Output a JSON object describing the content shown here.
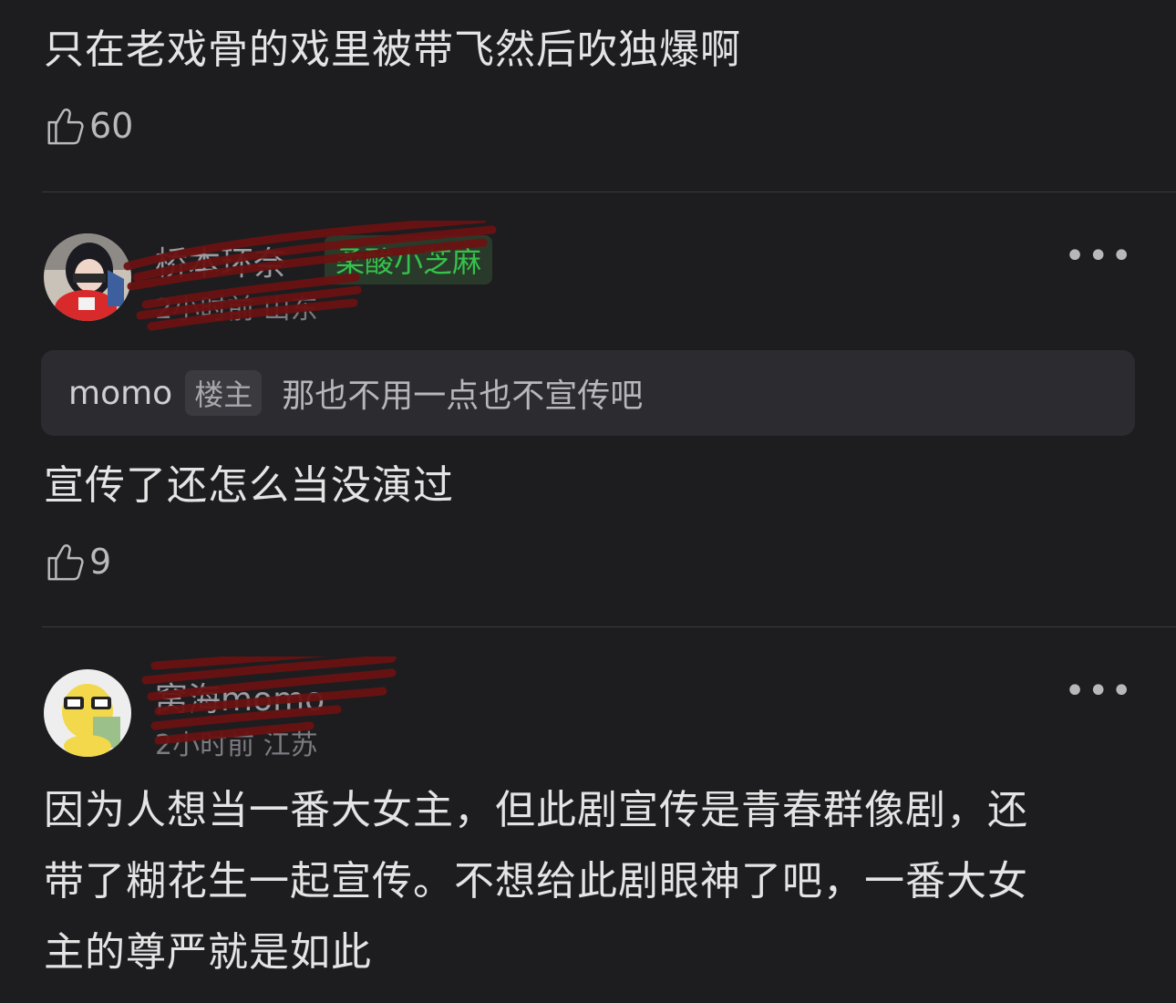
{
  "comment1": {
    "text": "只在老戏骨的戏里被带飞然后吹独爆啊",
    "likes": "60"
  },
  "comment2": {
    "username": "桥本环奈",
    "badge": "柔酸小芝麻",
    "time": "2小时前 山东",
    "quote": {
      "author": "momo",
      "tag": "楼主",
      "text": "那也不用一点也不宣传吧"
    },
    "text": "宣传了还怎么当没演过",
    "likes": "9"
  },
  "comment3": {
    "username": "窝海momo",
    "time": "2小时前 江苏",
    "text_lines": [
      "因为人想当一番大女主，但此剧宣传是青春群像剧，还",
      "带了糊花生一起宣传。不想给此剧眼神了吧，一番大女",
      "主的尊严就是如此"
    ]
  },
  "ui": {
    "more": "•••"
  }
}
